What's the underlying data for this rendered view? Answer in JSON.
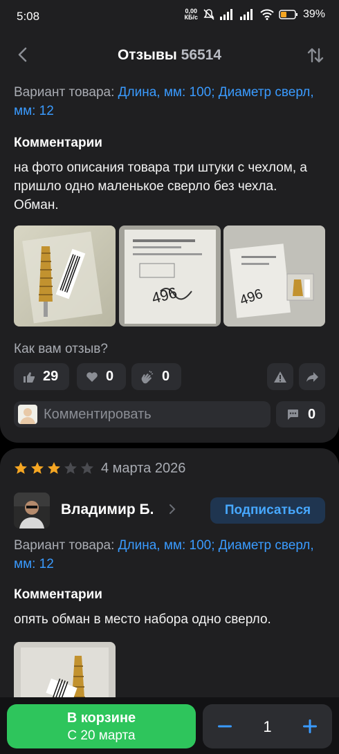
{
  "status_bar": {
    "time": "5:08",
    "speed_value": "0,00",
    "speed_unit": "КБ/с",
    "battery": "39%"
  },
  "header": {
    "title": "Отзывы",
    "count": "56514"
  },
  "review1": {
    "variant_label": "Вариант товара:",
    "variant_value": "Длина, мм: 100; Диаметр сверл, мм: 12",
    "comments_title": "Комментарии",
    "comment": "на фото описания товара три штуки с чехлом, а пришло одно маленькое сверло без чехла. Обман.",
    "photos": [
      "step-drill-package-photo",
      "shipping-label-photo",
      "package-with-drill-photo"
    ],
    "question": "Как вам отзыв?",
    "likes": "29",
    "hearts": "0",
    "claps": "0",
    "comment_placeholder": "Комментировать",
    "comment_count": "0"
  },
  "review2": {
    "rating": 3,
    "max_rating": 5,
    "date": "4 марта 2026",
    "author": "Владимир Б.",
    "subscribe_label": "Подписаться",
    "variant_label": "Вариант товара:",
    "variant_value": "Длина, мм: 100; Диаметр сверл, мм: 12",
    "comments_title": "Комментарии",
    "comment": "опять обман в место набора одно сверло."
  },
  "bottom_bar": {
    "cart_label": "В корзине",
    "cart_sub": "С 20 марта",
    "quantity": "1"
  },
  "colors": {
    "accent_blue": "#3a9bff",
    "green": "#2ec55c",
    "star": "#f5a623",
    "card": "#1f1f21"
  }
}
